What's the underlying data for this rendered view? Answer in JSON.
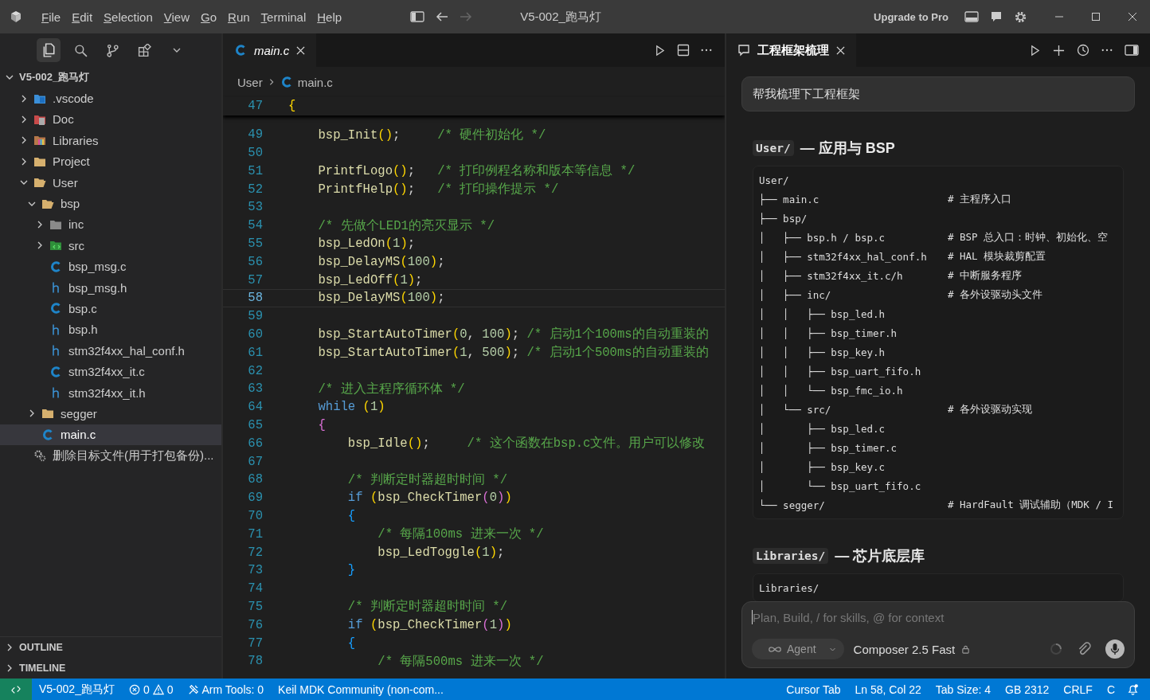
{
  "title_bar": {
    "menu": [
      "File",
      "Edit",
      "Selection",
      "View",
      "Go",
      "Run",
      "Terminal",
      "Help"
    ],
    "title": "V5-002_跑马灯",
    "upgrade": "Upgrade to Pro"
  },
  "activity_bar": [
    {
      "kind": "explorer",
      "selected": true
    },
    {
      "kind": "search",
      "selected": false
    },
    {
      "kind": "source-control",
      "selected": false
    },
    {
      "kind": "extensions",
      "selected": false
    }
  ],
  "explorer": {
    "tree": {
      "label": "V5-002_跑马灯",
      "kind": "root",
      "expanded": true,
      "selected": false,
      "children": [
        {
          "label": ".vscode",
          "kind": "vscode-folder",
          "expanded": false,
          "selected": false
        },
        {
          "label": "Doc",
          "kind": "doc-folder",
          "expanded": false,
          "selected": false
        },
        {
          "label": "Libraries",
          "kind": "lib-folder",
          "expanded": false,
          "selected": false
        },
        {
          "label": "Project",
          "kind": "folder",
          "expanded": false,
          "selected": false
        },
        {
          "label": "User",
          "kind": "folder",
          "expanded": true,
          "selected": false,
          "children": [
            {
              "label": "bsp",
              "kind": "folder",
              "expanded": true,
              "selected": false,
              "children": [
                {
                  "label": "inc",
                  "kind": "inc-folder",
                  "expanded": false,
                  "selected": false
                },
                {
                  "label": "src",
                  "kind": "src-folder",
                  "expanded": false,
                  "selected": false
                },
                {
                  "label": "bsp_msg.c",
                  "kind": "c-file",
                  "selected": false
                },
                {
                  "label": "bsp_msg.h",
                  "kind": "h-file",
                  "selected": false
                },
                {
                  "label": "bsp.c",
                  "kind": "c-file",
                  "selected": false
                },
                {
                  "label": "bsp.h",
                  "kind": "h-file",
                  "selected": false
                },
                {
                  "label": "stm32f4xx_hal_conf.h",
                  "kind": "h-file",
                  "selected": false
                },
                {
                  "label": "stm32f4xx_it.c",
                  "kind": "c-file",
                  "selected": false
                },
                {
                  "label": "stm32f4xx_it.h",
                  "kind": "h-file",
                  "selected": false
                }
              ]
            },
            {
              "label": "segger",
              "kind": "folder",
              "expanded": false,
              "selected": false
            },
            {
              "label": "main.c",
              "kind": "c-file",
              "selected": true
            }
          ]
        },
        {
          "label": "删除目标文件(用于打包备份)...",
          "kind": "script",
          "selected": false
        }
      ]
    }
  },
  "sections": [
    {
      "label": "OUTLINE",
      "expanded": false
    },
    {
      "label": "TIMELINE",
      "expanded": false
    }
  ],
  "editor": {
    "tabs": [
      {
        "label": "main.c",
        "selected": true
      }
    ],
    "breadcrumbs": [
      "User",
      "main.c"
    ],
    "sticky": {
      "n": "47",
      "t": [
        {
          "s": "{",
          "kind": "b1"
        }
      ]
    },
    "lines": [
      {
        "n": "49",
        "current": false,
        "t": [
          {
            "s": "    bsp_Init",
            "kind": "fn"
          },
          {
            "s": "()",
            "kind": "b1"
          },
          {
            "s": ";",
            "kind": "p"
          },
          {
            "s": "     /* 硬件初始化 */",
            "kind": "c"
          }
        ]
      },
      {
        "n": "50",
        "current": false
      },
      {
        "n": "51",
        "current": false,
        "t": [
          {
            "s": "    PrintfLogo",
            "kind": "fn"
          },
          {
            "s": "()",
            "kind": "b1"
          },
          {
            "s": ";",
            "kind": "p"
          },
          {
            "s": "   /* 打印例程名称和版本等信息 */",
            "kind": "c"
          }
        ]
      },
      {
        "n": "52",
        "current": false,
        "t": [
          {
            "s": "    PrintfHelp",
            "kind": "fn"
          },
          {
            "s": "()",
            "kind": "b1"
          },
          {
            "s": ";",
            "kind": "p"
          },
          {
            "s": "   /* 打印操作提示 */",
            "kind": "c"
          }
        ]
      },
      {
        "n": "53",
        "current": false
      },
      {
        "n": "54",
        "current": false,
        "t": [
          {
            "s": "    /* 先做个LED1的亮灭显示 */",
            "kind": "c"
          }
        ]
      },
      {
        "n": "55",
        "current": false,
        "t": [
          {
            "s": "    bsp_LedOn",
            "kind": "fn"
          },
          {
            "s": "(",
            "kind": "b1"
          },
          {
            "s": "1",
            "kind": "n"
          },
          {
            "s": ")",
            "kind": "b1"
          },
          {
            "s": ";",
            "kind": "p"
          }
        ]
      },
      {
        "n": "56",
        "current": false,
        "t": [
          {
            "s": "    bsp_DelayMS",
            "kind": "fn"
          },
          {
            "s": "(",
            "kind": "b1"
          },
          {
            "s": "100",
            "kind": "n"
          },
          {
            "s": ")",
            "kind": "b1"
          },
          {
            "s": ";",
            "kind": "p"
          }
        ]
      },
      {
        "n": "57",
        "current": false,
        "t": [
          {
            "s": "    bsp_LedOff",
            "kind": "fn"
          },
          {
            "s": "(",
            "kind": "b1"
          },
          {
            "s": "1",
            "kind": "n"
          },
          {
            "s": ")",
            "kind": "b1"
          },
          {
            "s": ";",
            "kind": "p"
          }
        ]
      },
      {
        "n": "58",
        "current": true,
        "t": [
          {
            "s": "    bsp_DelayMS",
            "kind": "fn"
          },
          {
            "s": "(",
            "kind": "b1"
          },
          {
            "s": "100",
            "kind": "n"
          },
          {
            "s": ")",
            "kind": "b1"
          },
          {
            "s": ";",
            "kind": "p"
          }
        ]
      },
      {
        "n": "59",
        "current": false
      },
      {
        "n": "60",
        "current": false,
        "t": [
          {
            "s": "    bsp_StartAutoTimer",
            "kind": "fn"
          },
          {
            "s": "(",
            "kind": "b1"
          },
          {
            "s": "0",
            "kind": "n"
          },
          {
            "s": ",",
            "kind": "p"
          },
          {
            "s": " 100",
            "kind": "n"
          },
          {
            "s": ")",
            "kind": "b1"
          },
          {
            "s": ";",
            "kind": "p"
          },
          {
            "s": " /* 启动1个100ms的自动重装的",
            "kind": "c"
          }
        ]
      },
      {
        "n": "61",
        "current": false,
        "t": [
          {
            "s": "    bsp_StartAutoTimer",
            "kind": "fn"
          },
          {
            "s": "(",
            "kind": "b1"
          },
          {
            "s": "1",
            "kind": "n"
          },
          {
            "s": ",",
            "kind": "p"
          },
          {
            "s": " 500",
            "kind": "n"
          },
          {
            "s": ")",
            "kind": "b1"
          },
          {
            "s": ";",
            "kind": "p"
          },
          {
            "s": " /* 启动1个500ms的自动重装的",
            "kind": "c"
          }
        ]
      },
      {
        "n": "62",
        "current": false
      },
      {
        "n": "63",
        "current": false,
        "t": [
          {
            "s": "    /* 进入主程序循环体 */",
            "kind": "c"
          }
        ]
      },
      {
        "n": "64",
        "current": false,
        "t": [
          {
            "s": "    while",
            "kind": "k"
          },
          {
            "s": " (",
            "kind": "b1"
          },
          {
            "s": "1",
            "kind": "n"
          },
          {
            "s": ")",
            "kind": "b1"
          }
        ]
      },
      {
        "n": "65",
        "current": false,
        "t": [
          {
            "s": "    {",
            "kind": "b2"
          }
        ]
      },
      {
        "n": "66",
        "current": false,
        "t": [
          {
            "s": "        bsp_Idle",
            "kind": "fn"
          },
          {
            "s": "()",
            "kind": "b1"
          },
          {
            "s": ";",
            "kind": "p"
          },
          {
            "s": "     /* 这个函数在bsp.c文件。用户可以修改",
            "kind": "c"
          }
        ]
      },
      {
        "n": "67",
        "current": false
      },
      {
        "n": "68",
        "current": false,
        "t": [
          {
            "s": "        /* 判断定时器超时时间 */",
            "kind": "c"
          }
        ]
      },
      {
        "n": "69",
        "current": false,
        "t": [
          {
            "s": "        if",
            "kind": "k"
          },
          {
            "s": " (",
            "kind": "b1"
          },
          {
            "s": "bsp_CheckTimer",
            "kind": "fn"
          },
          {
            "s": "(",
            "kind": "b2"
          },
          {
            "s": "0",
            "kind": "n"
          },
          {
            "s": ")",
            "kind": "b2"
          },
          {
            "s": ")",
            "kind": "b1"
          }
        ]
      },
      {
        "n": "70",
        "current": false,
        "t": [
          {
            "s": "        {",
            "kind": "b3"
          }
        ]
      },
      {
        "n": "71",
        "current": false,
        "t": [
          {
            "s": "            /* 每隔100ms 进来一次 */",
            "kind": "c"
          }
        ]
      },
      {
        "n": "72",
        "current": false,
        "t": [
          {
            "s": "            bsp_LedToggle",
            "kind": "fn"
          },
          {
            "s": "(",
            "kind": "b1"
          },
          {
            "s": "1",
            "kind": "n"
          },
          {
            "s": ")",
            "kind": "b1"
          },
          {
            "s": ";",
            "kind": "p"
          }
        ]
      },
      {
        "n": "73",
        "current": false,
        "t": [
          {
            "s": "        }",
            "kind": "b3"
          }
        ]
      },
      {
        "n": "74",
        "current": false
      },
      {
        "n": "75",
        "current": false,
        "t": [
          {
            "s": "        /* 判断定时器超时时间 */",
            "kind": "c"
          }
        ]
      },
      {
        "n": "76",
        "current": false,
        "t": [
          {
            "s": "        if",
            "kind": "k"
          },
          {
            "s": " (",
            "kind": "b1"
          },
          {
            "s": "bsp_CheckTimer",
            "kind": "fn"
          },
          {
            "s": "(",
            "kind": "b2"
          },
          {
            "s": "1",
            "kind": "n"
          },
          {
            "s": ")",
            "kind": "b2"
          },
          {
            "s": ")",
            "kind": "b1"
          }
        ]
      },
      {
        "n": "77",
        "current": false,
        "t": [
          {
            "s": "        {",
            "kind": "b3"
          }
        ]
      },
      {
        "n": "78",
        "current": false,
        "t": [
          {
            "s": "            /* 每隔500ms 进来一次 */",
            "kind": "c"
          }
        ]
      }
    ]
  },
  "chat": {
    "tab": "工程框架梳理",
    "user_message": "帮我梳理下工程框架",
    "sections": [
      {
        "code": "User/",
        "title": "— 应用与 BSP",
        "tree": [
          {
            "path": "User/"
          },
          {
            "path": "├── main.c",
            "comment": "# 主程序入口"
          },
          {
            "path": "├── bsp/"
          },
          {
            "path": "│   ├── bsp.h / bsp.c",
            "comment": "# BSP 总入口：时钟、初始化、空"
          },
          {
            "path": "│   ├── stm32f4xx_hal_conf.h",
            "comment": "# HAL 模块裁剪配置"
          },
          {
            "path": "│   ├── stm32f4xx_it.c/h",
            "comment": "# 中断服务程序"
          },
          {
            "path": "│   ├── inc/",
            "comment": "# 各外设驱动头文件"
          },
          {
            "path": "│   │   ├── bsp_led.h"
          },
          {
            "path": "│   │   ├── bsp_timer.h"
          },
          {
            "path": "│   │   ├── bsp_key.h"
          },
          {
            "path": "│   │   ├── bsp_uart_fifo.h"
          },
          {
            "path": "│   │   └── bsp_fmc_io.h"
          },
          {
            "path": "│   └── src/",
            "comment": "# 各外设驱动实现"
          },
          {
            "path": "│       ├── bsp_led.c"
          },
          {
            "path": "│       ├── bsp_timer.c"
          },
          {
            "path": "│       ├── bsp_key.c"
          },
          {
            "path": "│       └── bsp_uart_fifo.c"
          },
          {
            "path": "└── segger/",
            "comment": "# HardFault 调试辅助（MDK / I"
          }
        ]
      },
      {
        "code": "Libraries/",
        "title": "— 芯片底层库",
        "tree": [
          {
            "path": "Libraries/"
          }
        ]
      }
    ],
    "composer": {
      "placeholder": "Plan, Build, / for skills, @ for context",
      "mode": "Agent",
      "model": "Composer 2.5 Fast"
    }
  },
  "status_bar": {
    "left": [
      {
        "kind": "remote"
      },
      {
        "kind": "text",
        "label": "V5-002_跑马灯"
      },
      {
        "kind": "problems",
        "errors": "0",
        "warnings": "0"
      },
      {
        "kind": "tools",
        "label": "Arm Tools: 0"
      },
      {
        "kind": "text",
        "label": "Keil MDK Community (non-com..."
      }
    ],
    "right": [
      "Cursor Tab",
      "Ln 58, Col 22",
      "Tab Size: 4",
      "GB 2312",
      "CRLF",
      "C"
    ]
  }
}
